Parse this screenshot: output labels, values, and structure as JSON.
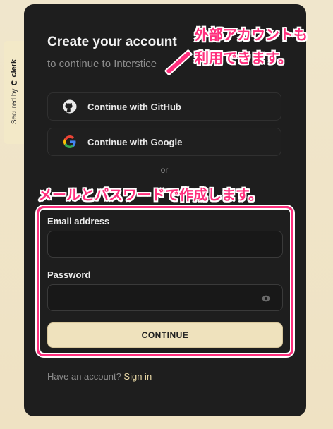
{
  "badge": {
    "secured_by": "Secured by",
    "brand": "clerk"
  },
  "auth": {
    "title": "Create your account",
    "subtitle": "to continue to Interstice",
    "github_label": "Continue with GitHub",
    "google_label": "Continue with Google",
    "divider": "or",
    "email_label": "Email address",
    "email_value": "",
    "password_label": "Password",
    "password_value": "",
    "continue_label": "CONTINUE",
    "footer_text": "Have an account?",
    "footer_link": "Sign in"
  },
  "annotations": {
    "note1_line1": "外部アカウントも",
    "note1_line2": "利用できます。",
    "note2": "メールとパスワードで作成します。",
    "color": "#ff2f7d"
  },
  "icons": {
    "github": "github-icon",
    "google": "google-icon",
    "eye": "eye-icon",
    "clerk": "clerk-logo-icon"
  }
}
